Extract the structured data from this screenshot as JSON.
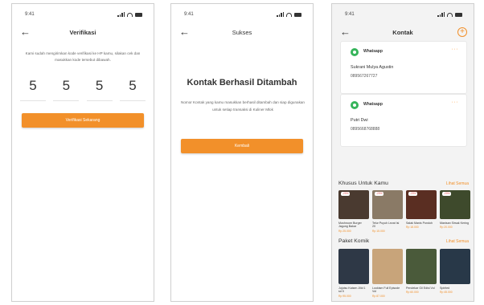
{
  "status_time": "9:41",
  "screen1": {
    "title": "Verifikasi",
    "description": "Kami sudah mengirimkan kode verifikasi ke HP kamu, silakan cek dan masukkan kode tersebut dibawah.",
    "otp_digits": [
      "5",
      "5",
      "5",
      "5"
    ],
    "button_label": "Verifikasi Sekarang"
  },
  "screen2": {
    "title": "Sukses",
    "heading": "Kontak Berhasil Ditambah",
    "description": "Nomor Kontak yang kamu masukkan berhasil ditambah dan siap digunakan untuk setiap transaksi di Kuliner Mlok",
    "button_label": "Kembali"
  },
  "screen3": {
    "title": "Kontak",
    "contacts": [
      {
        "app": "Whatsapp",
        "name": "Sukrani Mulya Agustin",
        "phone": "089567267727"
      },
      {
        "app": "Whatsapp",
        "name": "Putri Dwi",
        "phone": "0895668768888"
      }
    ],
    "section1": {
      "title": "Khusus Untuk Kamu",
      "see_all": "Lihat Semua",
      "items": [
        {
          "badge": "-20%",
          "name": "Mushroom Burger Jagung Bakar",
          "price": "Rp 25.000",
          "color": "#4a3a30"
        },
        {
          "badge": "-20%",
          "name": "Telur Puyuh Lezat Isi 20",
          "price": "Rp 15.000",
          "color": "#8a7a66"
        },
        {
          "badge": "-20%",
          "name": "Salak Manis Pondoh",
          "price": "Rp 18.000",
          "color": "#5a2e22"
        },
        {
          "badge": "-20%",
          "name": "Manisan Sirsak Kering",
          "price": "Rp 20.000",
          "color": "#3e4a2c"
        }
      ]
    },
    "section2": {
      "title": "Paket Komik",
      "see_all": "Lihat Semua",
      "items": [
        {
          "name": "Jujutsu Kaisen Jilid 1 sd 5",
          "price": "Rp 95.000",
          "color": "#2e3846"
        },
        {
          "name": "Lookism Full Episode Vol",
          "price": "Rp 87.000",
          "color": "#c8a47a"
        },
        {
          "name": "Pendekar Gil Edisi Vol",
          "price": "Rp 60.000",
          "color": "#4a5a3a"
        },
        {
          "name": "Spirited",
          "price": "Rp 45.000",
          "color": "#283848"
        }
      ]
    }
  }
}
